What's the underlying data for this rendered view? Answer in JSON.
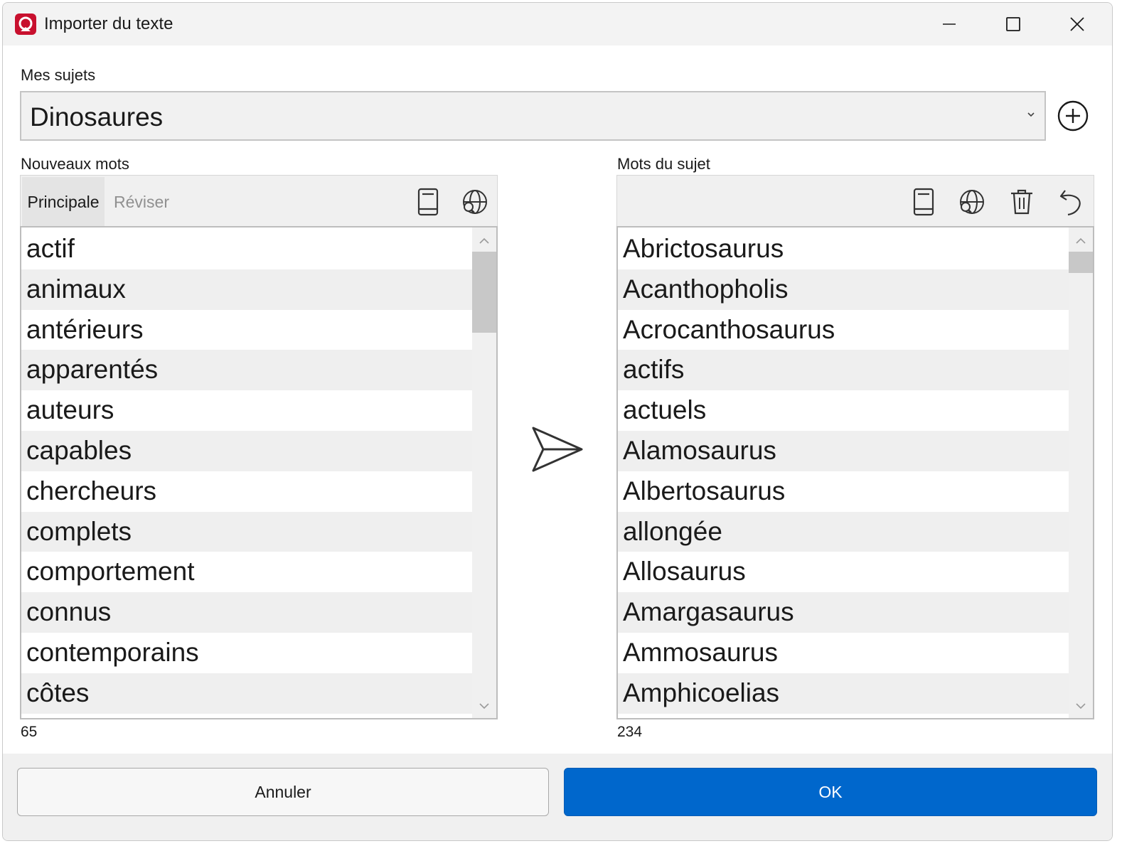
{
  "window": {
    "title": "Importer du texte",
    "brand_color": "#c8102e"
  },
  "subject": {
    "label": "Mes sujets",
    "selected": "Dinosaures"
  },
  "new_words": {
    "label": "Nouveaux mots",
    "tabs": [
      "Principale",
      "Réviser"
    ],
    "active_tab": "Principale",
    "items": [
      "actif",
      "animaux",
      "antérieurs",
      "apparentés",
      "auteurs",
      "capables",
      "chercheurs",
      "complets",
      "comportement",
      "connus",
      "contemporains",
      "côtes"
    ],
    "count": "65"
  },
  "subject_words": {
    "label": "Mots du sujet",
    "items": [
      "Abrictosaurus",
      "Acanthopholis",
      "Acrocanthosaurus",
      "actifs",
      "actuels",
      "Alamosaurus",
      "Albertosaurus",
      "allongée",
      "Allosaurus",
      "Amargasaurus",
      "Ammosaurus",
      "Amphicoelias"
    ],
    "count": "234"
  },
  "footer": {
    "cancel": "Annuler",
    "ok": "OK",
    "ok_color": "#0067cc"
  }
}
